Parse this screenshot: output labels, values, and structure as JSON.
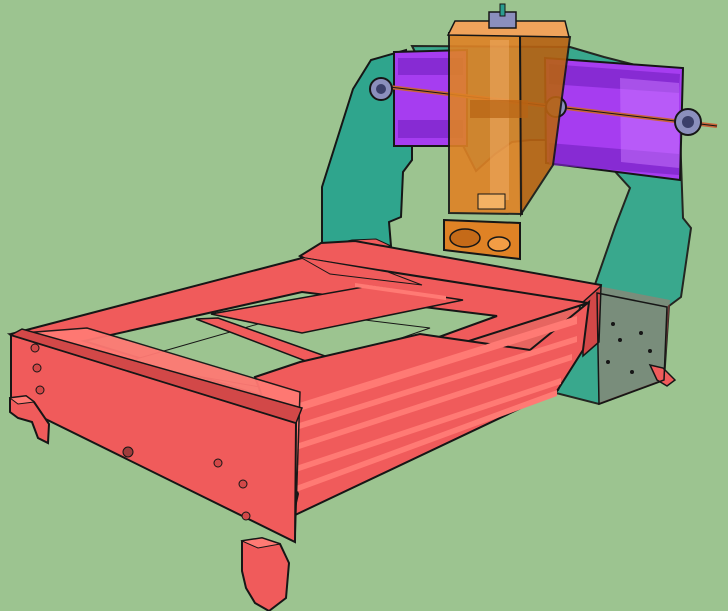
{
  "image": {
    "subject": "cnc-router-3d-model",
    "colors": {
      "background": "#9cc490",
      "frame": "#f05b5b",
      "frame_dark": "#d24848",
      "frame_light": "#ff7a74",
      "side_plate": "#2fa58d",
      "side_plate_dark": "#238672",
      "gantry_rail": "#a63df0",
      "gantry_rail_dark": "#7b24c6",
      "z_axis": "#df8225",
      "z_axis_dark": "#b86212",
      "rod": "#8b8fbd",
      "leadscrew": "#c86438",
      "outline": "#161616"
    }
  }
}
